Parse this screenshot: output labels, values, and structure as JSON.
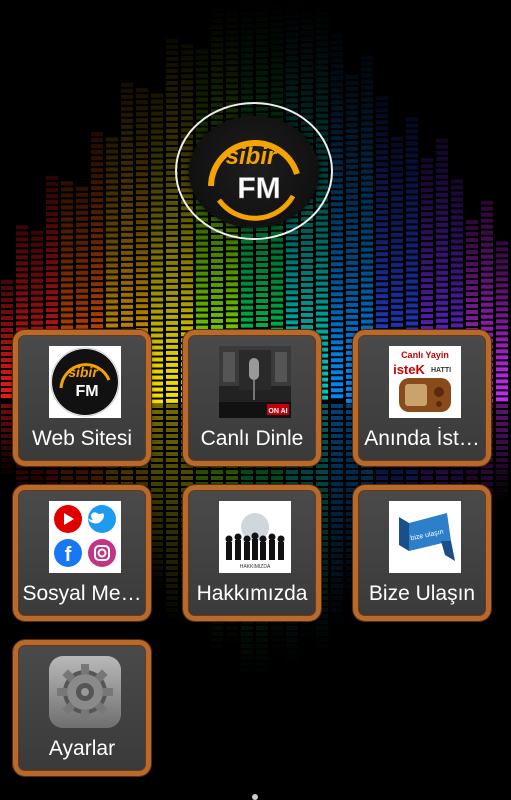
{
  "logo": {
    "alt": "sibir FM",
    "line1": "sibir",
    "line2": "FM"
  },
  "tiles": [
    {
      "label": "Web Sitesi",
      "icon": "sibir-fm-logo-icon",
      "logo_text1": "sibir",
      "logo_text2": "FM"
    },
    {
      "label": "Canlı Dinle",
      "icon": "studio-microphone-icon",
      "on_air_text": "ON AI"
    },
    {
      "label": "Anında İst…",
      "icon": "radio-request-icon",
      "thumb_title": "Canlı Yayin",
      "thumb_word": "isteK",
      "thumb_word2": "HATTI"
    },
    {
      "label": "Sosyal Me…",
      "icon": "social-media-icon"
    },
    {
      "label": "Hakkımızda",
      "icon": "people-globe-icon",
      "thumb_caption": "HAKKIMIZDA"
    },
    {
      "label": "Bize Ulaşın",
      "icon": "contact-banner-icon",
      "thumb_text": "bize ulaşın"
    },
    {
      "label": "Ayarlar",
      "icon": "settings-gears-icon"
    }
  ],
  "colors": {
    "tile_border": "#b86a2c",
    "tile_bg": "#444444",
    "logo_accent": "#f5a300"
  }
}
